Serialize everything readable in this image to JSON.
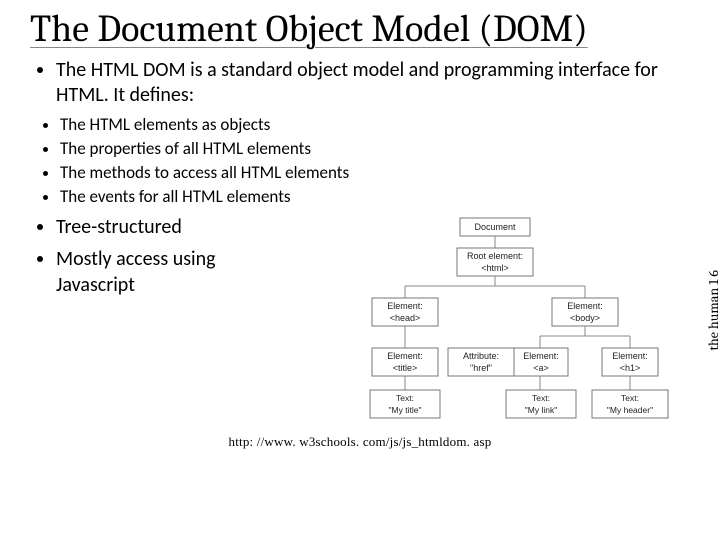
{
  "title": "The Document Object Model (DOM)",
  "bullets1": [
    "The HTML DOM is a standard object model and programming interface for HTML. It defines:"
  ],
  "bullets2": [
    "The HTML elements as objects",
    "The properties of all HTML elements",
    "The methods to access all HTML elements",
    "The events for all HTML elements"
  ],
  "bullets3": [
    "Tree-structured",
    "Mostly access using Javascript"
  ],
  "diagram": {
    "nodes": {
      "document": "Document",
      "root1": "Root element:",
      "root2": "<html>",
      "head1": "Element:",
      "head2": "<head>",
      "body1": "Element:",
      "body2": "<body>",
      "titleEl1": "Element:",
      "titleEl2": "<title>",
      "attr1": "Attribute:",
      "attr2": "\"href\"",
      "a1": "Element:",
      "a2": "<a>",
      "h1a": "Element:",
      "h1b": "<h1>",
      "txt1a": "Text:",
      "txt1b": "\"My title\"",
      "txt2a": "Text:",
      "txt2b": "\"My link\"",
      "txt3a": "Text:",
      "txt3b": "\"My header\""
    }
  },
  "caption": "http: //www. w3schools. com/js/js_htmldom. asp",
  "sidelabel": "the human 1   6"
}
